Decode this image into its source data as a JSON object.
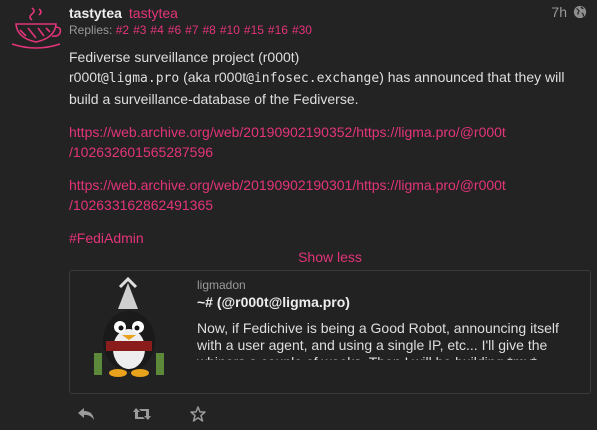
{
  "post": {
    "display_name": "tastytea",
    "handle": "tastytea",
    "time": "7h",
    "replies_label": "Replies:",
    "replies": [
      "#2",
      "#3",
      "#4",
      "#6",
      "#7",
      "#8",
      "#10",
      "#15",
      "#16",
      "#30"
    ],
    "line1": "Fediverse surveillance project (r000t)",
    "line2_a": "r000t",
    "line2_b": "@ligma.pro",
    "line2_c": " (aka r000t",
    "line2_d": "@infosec.exchange",
    "line2_e": ") has announced that they will build a surveillance-database of the Fediverse.",
    "link1_a": "https://web.archive.org/web/20190902190352/https://ligma.pro/@r000t",
    "link1_b": "/102632601565287596",
    "link2_a": "https://web.archive.org/web/20190902190301/https://ligma.pro/@r000t",
    "link2_b": "/102633162862491365",
    "hashtag": "#FediAdmin",
    "show_less": "Show less"
  },
  "card": {
    "site": "ligmadon",
    "title": "~# (@r000t@ligma.pro)",
    "description": "Now, if Fedichive is being a Good Robot, announcing itself with a user agent, and using a single IP, etc... I'll give the whiners a couple of weeks. Then I will be building *my*"
  },
  "icons": {
    "avatar": "teacup-logo",
    "visibility": "globe-icon",
    "reply": "reply-icon",
    "boost": "boost-icon",
    "favourite": "star-icon"
  },
  "colors": {
    "accent": "#e3347a",
    "background": "#232323",
    "text": "#dedede",
    "muted": "#9a9a9a"
  }
}
